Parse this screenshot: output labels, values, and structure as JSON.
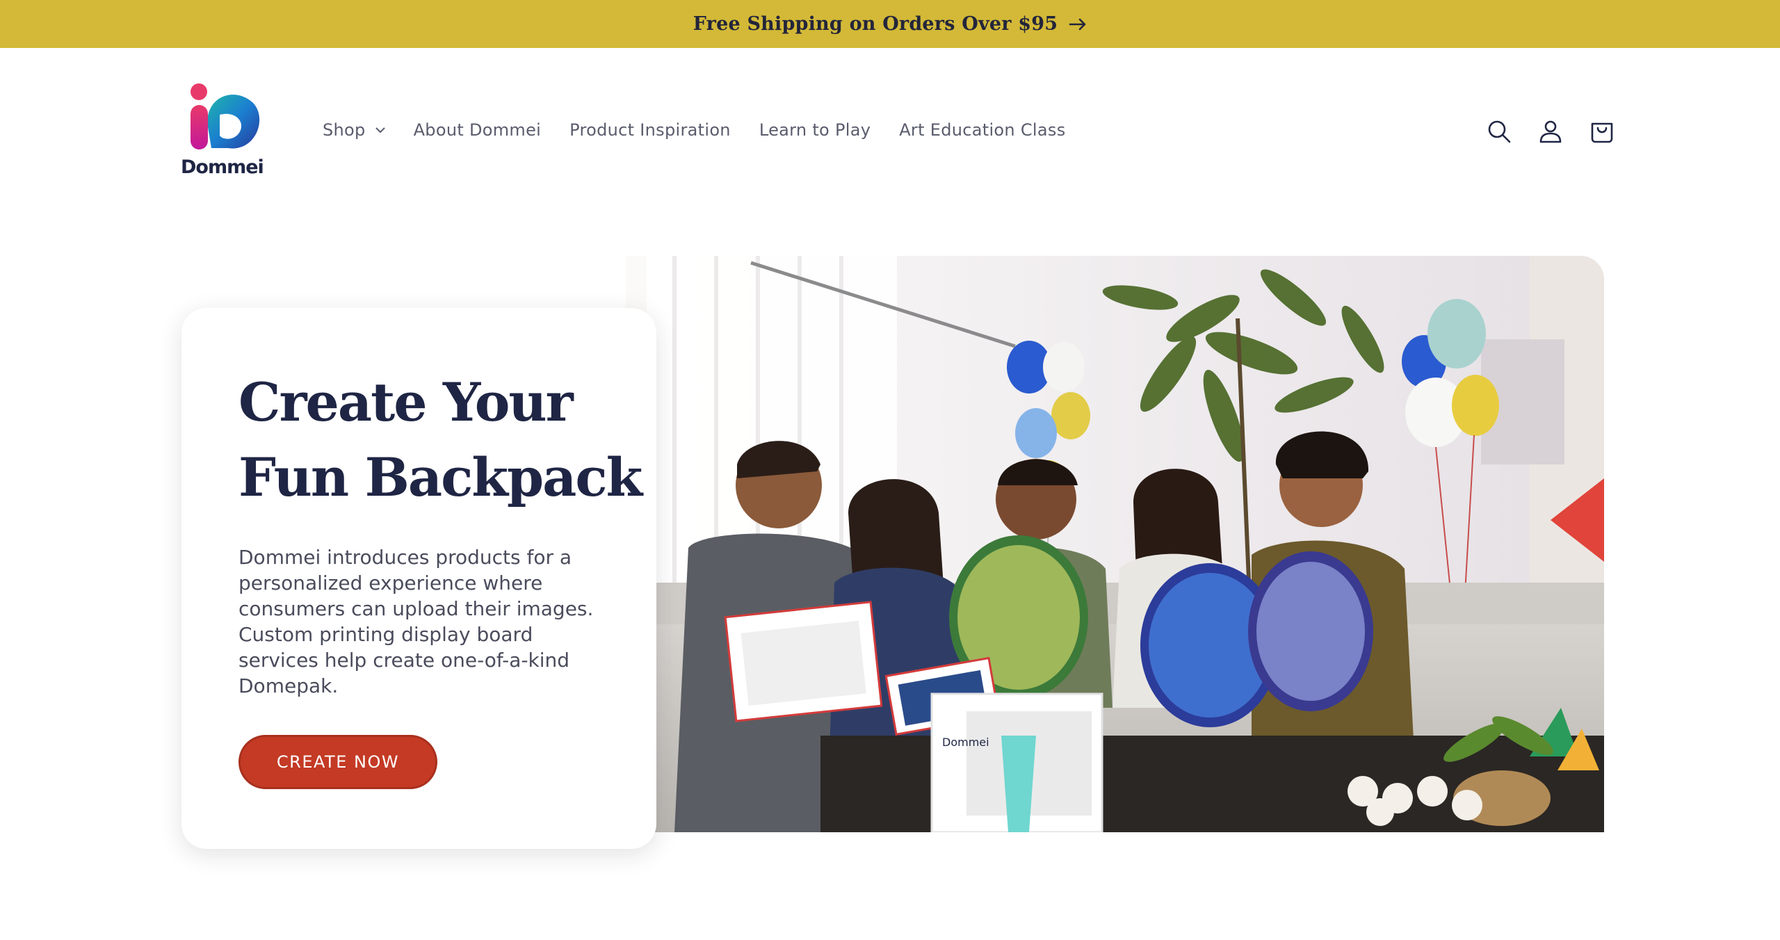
{
  "announcement": {
    "text": "Free Shipping on Orders Over $95"
  },
  "brand": {
    "name": "Dommei"
  },
  "nav": {
    "items": [
      {
        "label": "Shop"
      },
      {
        "label": "About Dommei"
      },
      {
        "label": "Product Inspiration"
      },
      {
        "label": "Learn to Play"
      },
      {
        "label": "Art Education Class"
      }
    ]
  },
  "header_icons": [
    "search-icon",
    "account-icon",
    "cart-icon"
  ],
  "hero": {
    "title_line1": "Create Your",
    "title_line2": "Fun Backpack",
    "description": "Dommei introduces products for a personalized experience where consumers can upload their images. Custom printing display board services help create one-of-a-kind Domepak.",
    "cta_label": "CREATE NOW",
    "box_brand": "Dommei"
  },
  "colors": {
    "announcement_bg": "#d3b937",
    "navy": "#1f2544",
    "cta": "#c43a25"
  }
}
